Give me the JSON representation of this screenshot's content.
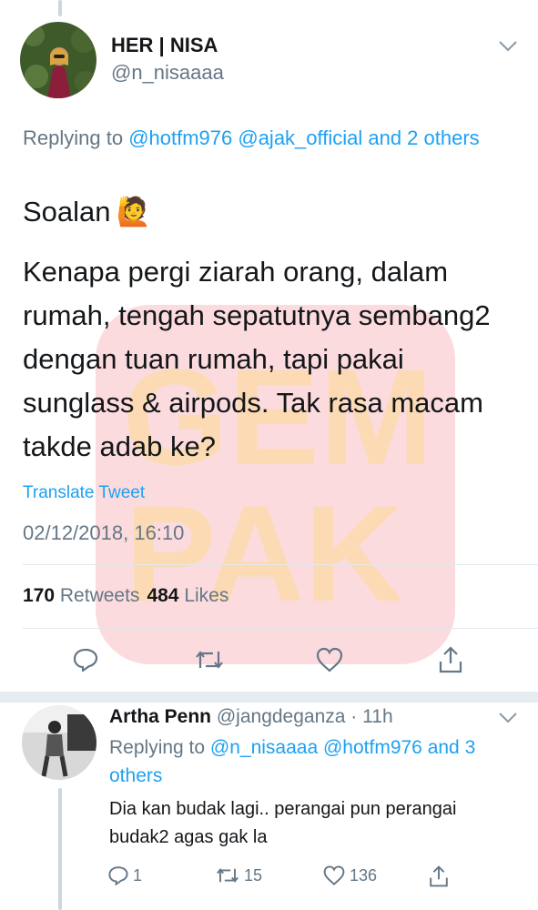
{
  "tweet": {
    "display_name": "HER | NISA",
    "handle": "@n_nisaaaa",
    "replying_prefix": "Replying to ",
    "replying_mentions": "@hotfm976 @ajak_official",
    "replying_and": " and 2 others",
    "line1": "Soalan",
    "emoji": "🙋",
    "body": "Kenapa pergi ziarah orang, dalam rumah, tengah sepatutnya sembang2 dengan tuan rumah, tapi pakai sunglass & airpods. Tak rasa macam takde adab ke?",
    "translate_label": "Translate Tweet",
    "timestamp": "02/12/2018, 16:10",
    "retweets_count": "170",
    "retweets_label": "Retweets",
    "likes_count": "484",
    "likes_label": "Likes"
  },
  "reply": {
    "display_name": "Artha Penn",
    "handle": "@jangdeganza",
    "time": "11h",
    "replying_prefix": "Replying to ",
    "replying_mentions": "@n_nisaaaa @hotfm976",
    "replying_and": " and 3 others",
    "text": "Dia kan budak lagi.. perangai pun perangai budak2 agas gak la",
    "reply_count": "1",
    "retweet_count": "15",
    "like_count": "136"
  },
  "watermark": {
    "line1": "GEM",
    "line2": "PAK"
  },
  "colors": {
    "link": "#1da1f2",
    "muted": "#657786",
    "watermark": "#f02a3b"
  }
}
